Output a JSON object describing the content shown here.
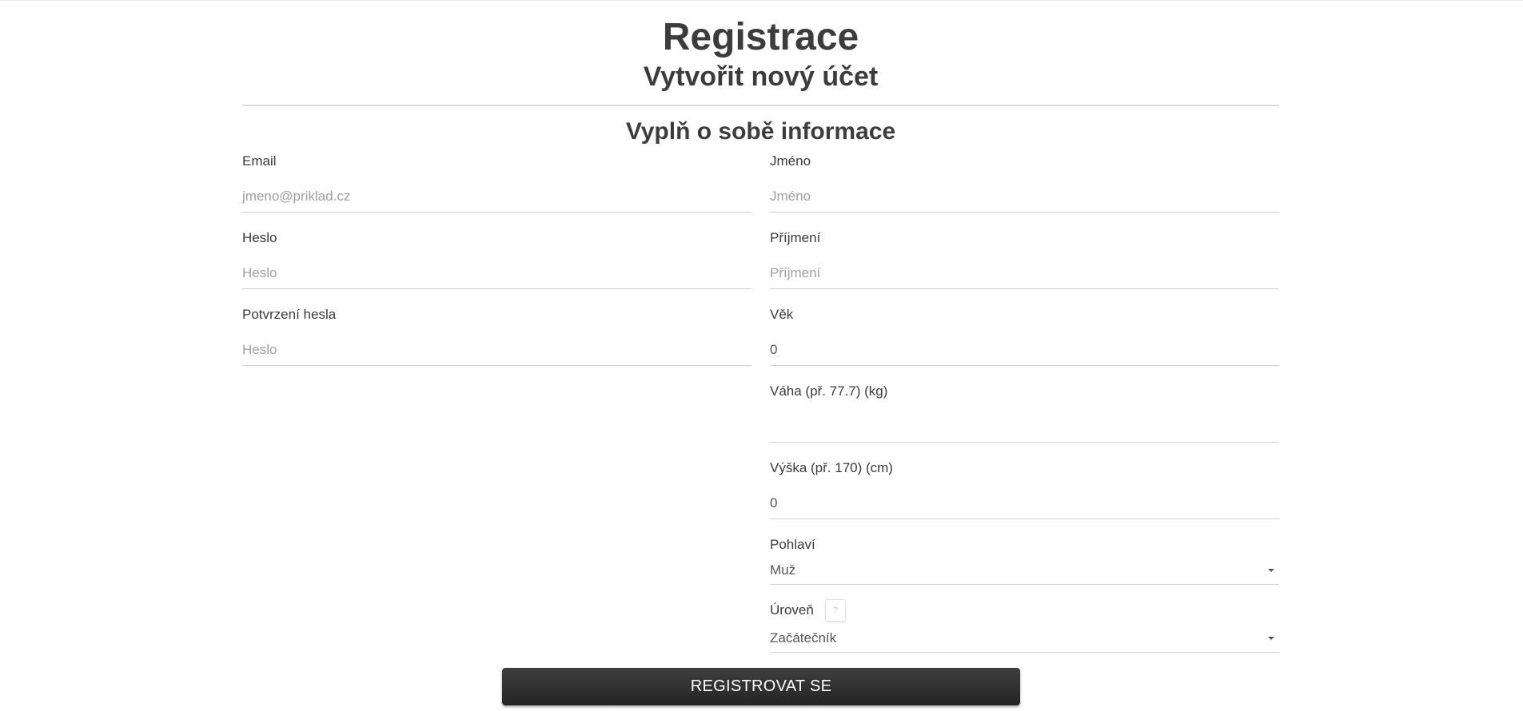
{
  "header": {
    "title": "Registrace",
    "subtitle": "Vytvořit nový účet"
  },
  "section": {
    "title": "Vyplň o sobě informace"
  },
  "left_fields": [
    {
      "label": "Email",
      "placeholder": "jmeno@priklad.cz",
      "value": ""
    },
    {
      "label": "Heslo",
      "placeholder": "Heslo",
      "value": ""
    },
    {
      "label": "Potvrzení hesla",
      "placeholder": "Heslo",
      "value": ""
    }
  ],
  "right_fields": [
    {
      "label": "Jméno",
      "placeholder": "Jméno",
      "value": ""
    },
    {
      "label": "Příjmení",
      "placeholder": "Příjmení",
      "value": ""
    },
    {
      "label": "Věk",
      "placeholder": "",
      "value": "0"
    },
    {
      "label": "Váha (př. 77.7) (kg)",
      "placeholder": "",
      "value": ""
    },
    {
      "label": "Výška (př. 170) (cm)",
      "placeholder": "",
      "value": "0"
    }
  ],
  "gender": {
    "label": "Pohlaví",
    "selected": "Muž",
    "icon": "chevron-down-icon"
  },
  "level": {
    "label": "Úroveň",
    "help_label": "?",
    "selected": "Začátečník",
    "icon": "chevron-down-icon"
  },
  "submit": {
    "label": "REGISTROVAT SE"
  }
}
